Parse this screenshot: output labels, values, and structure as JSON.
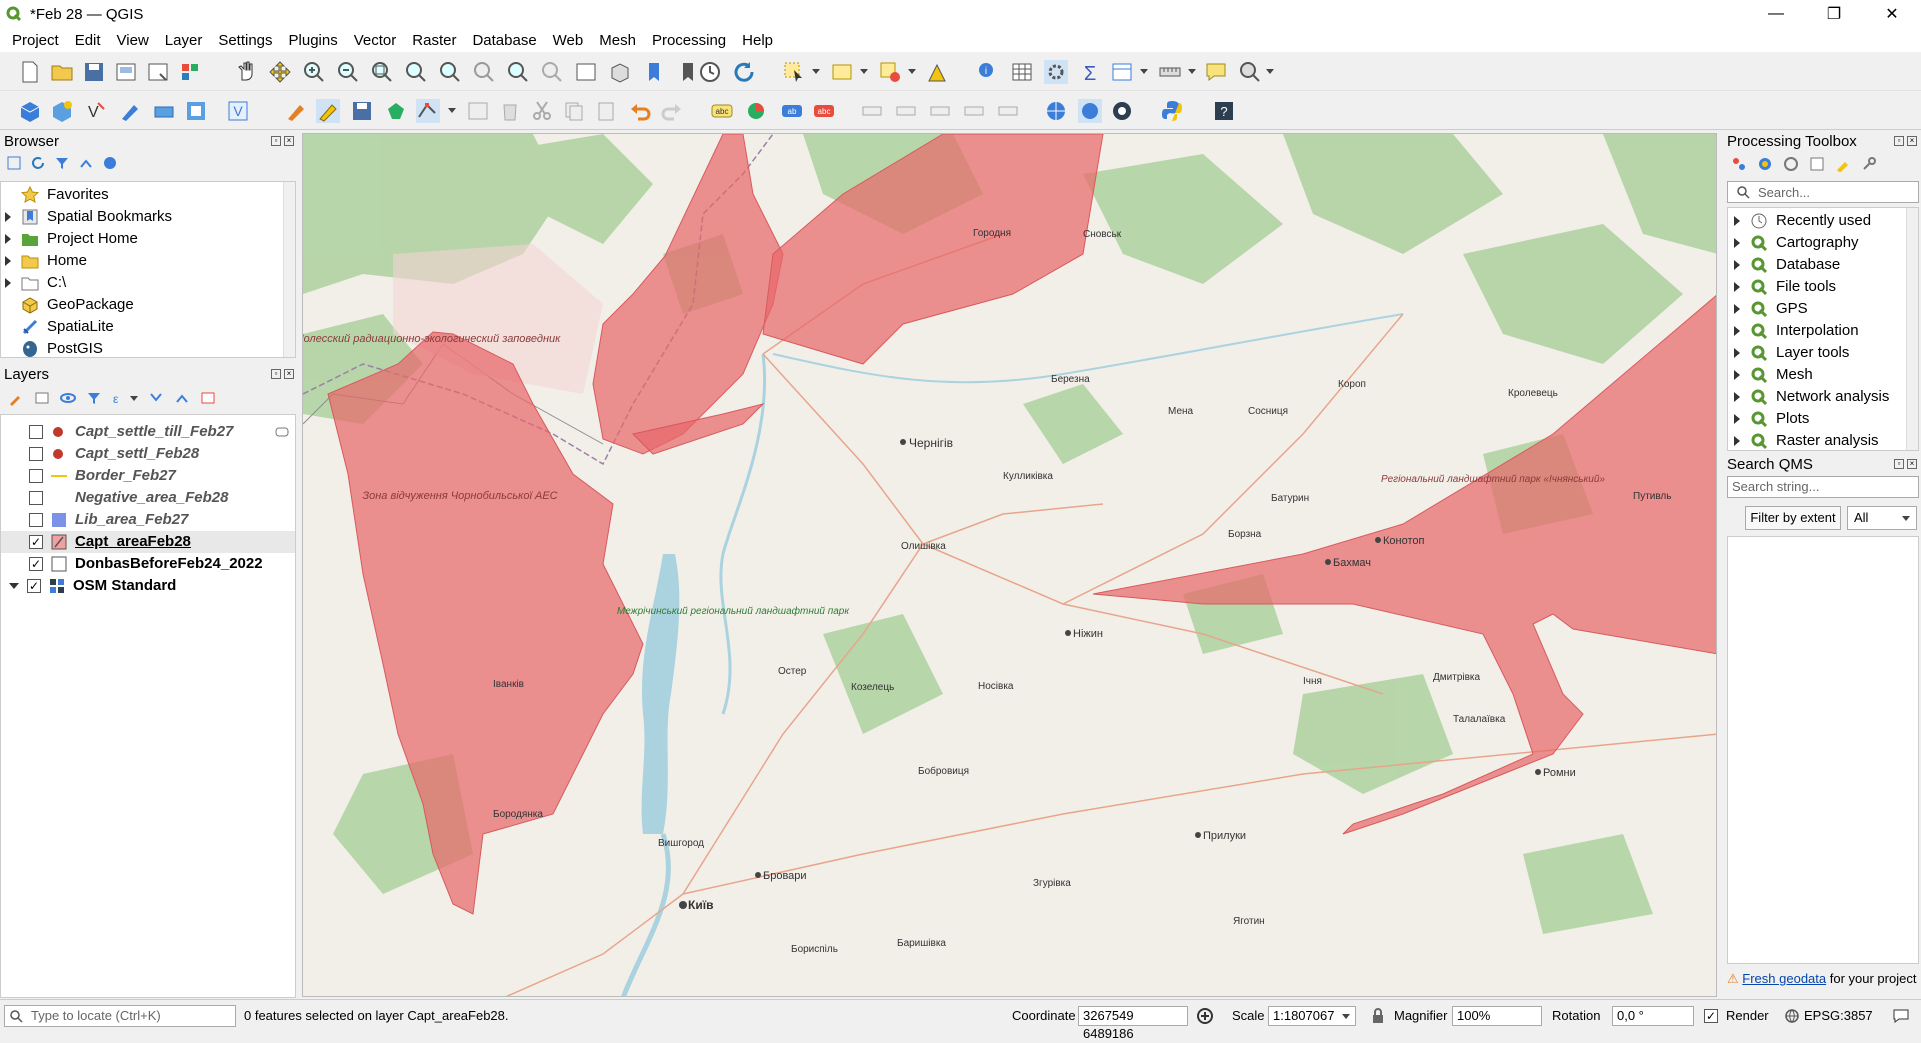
{
  "window": {
    "title": "*Feb 28 — QGIS",
    "minimize": "—",
    "maximize": "❐",
    "close": "✕"
  },
  "menu": [
    "Project",
    "Edit",
    "View",
    "Layer",
    "Settings",
    "Plugins",
    "Vector",
    "Raster",
    "Database",
    "Web",
    "Mesh",
    "Processing",
    "Help"
  ],
  "browser": {
    "title": "Browser",
    "items": [
      {
        "label": "Favorites",
        "expandable": false,
        "icon": "star-icon"
      },
      {
        "label": "Spatial Bookmarks",
        "expandable": true,
        "icon": "bookmark-icon"
      },
      {
        "label": "Project Home",
        "expandable": true,
        "icon": "folder-icon"
      },
      {
        "label": "Home",
        "expandable": true,
        "icon": "folder-icon"
      },
      {
        "label": "C:\\",
        "expandable": true,
        "icon": "drive-icon"
      },
      {
        "label": "GeoPackage",
        "expandable": false,
        "icon": "geopackage-icon"
      },
      {
        "label": "SpatiaLite",
        "expandable": false,
        "icon": "spatialite-icon"
      },
      {
        "label": "PostGIS",
        "expandable": false,
        "icon": "postgis-icon"
      }
    ]
  },
  "layers": {
    "title": "Layers",
    "items": [
      {
        "name": "Capt_settle_till_Feb27",
        "checked": false,
        "symbol": "point-red"
      },
      {
        "name": "Capt_settl_Feb28",
        "checked": false,
        "symbol": "point-red"
      },
      {
        "name": "Border_Feb27",
        "checked": false,
        "symbol": "line-yellow"
      },
      {
        "name": "Negative_area_Feb28",
        "checked": false,
        "symbol": "none"
      },
      {
        "name": "Lib_area_Feb27",
        "checked": false,
        "symbol": "fill-blue"
      },
      {
        "name": "Capt_areaFeb28",
        "checked": true,
        "symbol": "fill-red"
      },
      {
        "name": "DonbasBeforeFeb24_2022",
        "checked": true,
        "symbol": "outline"
      },
      {
        "name": "OSM Standard",
        "checked": true,
        "symbol": "raster"
      }
    ]
  },
  "toolbox": {
    "title": "Processing Toolbox",
    "search_placeholder": "Search...",
    "items": [
      "Recently used",
      "Cartography",
      "Database",
      "File tools",
      "GPS",
      "Interpolation",
      "Layer tools",
      "Mesh",
      "Network analysis",
      "Plots",
      "Raster analysis"
    ]
  },
  "qms": {
    "title": "Search QMS",
    "search_placeholder": "Search string...",
    "filter_label": "Filter by extent",
    "select_value": "All",
    "footer_link": "Fresh geodata",
    "footer_text": " for your project"
  },
  "map_labels": [
    {
      "t": "Полесский радиационно-экологический заповедник",
      "c": "#8b3a3a"
    },
    {
      "t": "Зона відчуження Чорнобильської АЕС",
      "c": "#8b3a3a"
    },
    {
      "t": "Межрічинський регіональний ландшафтний парк",
      "c": "#2e7d32"
    },
    {
      "t": "Регіональний ландшафтний парк «Ічнянський»",
      "c": "#8b3a3a"
    },
    {
      "t": "Чернігів",
      "c": "#333"
    },
    {
      "t": "Ніжин",
      "c": "#333"
    },
    {
      "t": "Бровари",
      "c": "#333"
    },
    {
      "t": "Київ",
      "c": "#333"
    },
    {
      "t": "Прилуки",
      "c": "#333"
    },
    {
      "t": "Бахмач",
      "c": "#333"
    },
    {
      "t": "Конотоп",
      "c": "#333"
    },
    {
      "t": "Ромни",
      "c": "#333"
    },
    {
      "t": "Козелець",
      "c": "#333"
    },
    {
      "t": "Остер",
      "c": "#333"
    },
    {
      "t": "Бобровиця",
      "c": "#333"
    },
    {
      "t": "Носівка",
      "c": "#333"
    },
    {
      "t": "Городня",
      "c": "#333"
    },
    {
      "t": "Сновськ",
      "c": "#333"
    },
    {
      "t": "Мена",
      "c": "#333"
    },
    {
      "t": "Сосниця",
      "c": "#333"
    },
    {
      "t": "Ічня",
      "c": "#333"
    },
    {
      "t": "Дмитрівка",
      "c": "#333"
    },
    {
      "t": "Талалаївка",
      "c": "#333"
    },
    {
      "t": "Березна",
      "c": "#333"
    },
    {
      "t": "Кулликівка",
      "c": "#333"
    },
    {
      "t": "Олишівка",
      "c": "#333"
    },
    {
      "t": "Іванків",
      "c": "#333"
    },
    {
      "t": "Бородянка",
      "c": "#333"
    },
    {
      "t": "Вишгород",
      "c": "#333"
    },
    {
      "t": "Бориспіль",
      "c": "#333"
    },
    {
      "t": "Баришівка",
      "c": "#333"
    },
    {
      "t": "Згурівка",
      "c": "#333"
    },
    {
      "t": "Яготин",
      "c": "#333"
    },
    {
      "t": "Короп",
      "c": "#333"
    },
    {
      "t": "Кролевець",
      "c": "#333"
    },
    {
      "t": "Путивль",
      "c": "#333"
    },
    {
      "t": "Батурин",
      "c": "#333"
    },
    {
      "t": "Борзна",
      "c": "#333"
    }
  ],
  "status": {
    "locate_placeholder": "Type to locate (Ctrl+K)",
    "message": "0 features selected on layer Capt_areaFeb28.",
    "coordinate_label": "Coordinate",
    "coordinate_value": "3267549 6489186",
    "scale_label": "Scale",
    "scale_value": "1:1807067",
    "magnifier_label": "Magnifier",
    "magnifier_value": "100%",
    "rotation_label": "Rotation",
    "rotation_value": "0,0 °",
    "render_label": "Render",
    "crs": "EPSG:3857"
  },
  "colors": {
    "accent": "#589632",
    "capture_fill": "#e8686b",
    "water": "#aad3df",
    "forest": "#add19e"
  }
}
